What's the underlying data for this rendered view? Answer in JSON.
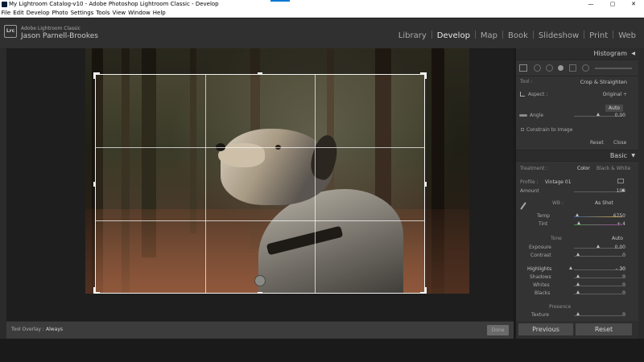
{
  "window": {
    "title": "My Lightroom Catalog-v10 - Adobe Photoshop Lightroom Classic - Develop",
    "minimize": "—",
    "maximize": "▢",
    "close": "✕"
  },
  "menu": [
    "File",
    "Edit",
    "Develop",
    "Photo",
    "Settings",
    "Tools",
    "View",
    "Window",
    "Help"
  ],
  "identity": {
    "logo": "Lrc",
    "product": "Adobe Lightroom Classic",
    "user": "Jason Parnell-Brookes"
  },
  "modules": [
    "Library",
    "Develop",
    "Map",
    "Book",
    "Slideshow",
    "Print",
    "Web"
  ],
  "active_module": "Develop",
  "toolbar": {
    "overlay_label": "Tool Overlay :",
    "overlay_value": "Always",
    "done_label": "Done"
  },
  "histogram": {
    "title": "Histogram",
    "collapse": "◀"
  },
  "crop": {
    "tool_label": "Tool :",
    "tool_value": "Crop & Straighten",
    "aspect_label": "Aspect :",
    "aspect_value": "Original ÷",
    "auto_label": "Auto",
    "angle_label": "Angle",
    "angle_value": "0.00",
    "constrain_label": "Constrain to Image",
    "reset_label": "Reset",
    "close_label": "Close"
  },
  "basic": {
    "title": "Basic",
    "collapse": "▼",
    "treatment_label": "Treatment :",
    "color_label": "Color",
    "bw_label": "Black & White",
    "profile_label": "Profile :",
    "profile_value": "Vintage 01",
    "amount_label": "Amount",
    "amount_value": "100",
    "wb_label": "WB :",
    "wb_value": "As Shot",
    "temp_label": "Temp",
    "temp_value": "6750",
    "tint_label": "Tint",
    "tint_value": "+ 4",
    "tone_label": "Tone",
    "tone_auto": "Auto",
    "sliders": [
      {
        "label": "Exposure",
        "value": "0.00"
      },
      {
        "label": "Contrast",
        "value": "0"
      },
      {
        "label": "Highlights",
        "value": "– 30"
      },
      {
        "label": "Shadows",
        "value": "0"
      },
      {
        "label": "Whites",
        "value": "0"
      },
      {
        "label": "Blacks",
        "value": "0"
      }
    ],
    "presence_label": "Presence",
    "texture_label": "Texture",
    "texture_value": "0"
  },
  "buttons": {
    "previous": "Previous",
    "reset": "Reset"
  }
}
